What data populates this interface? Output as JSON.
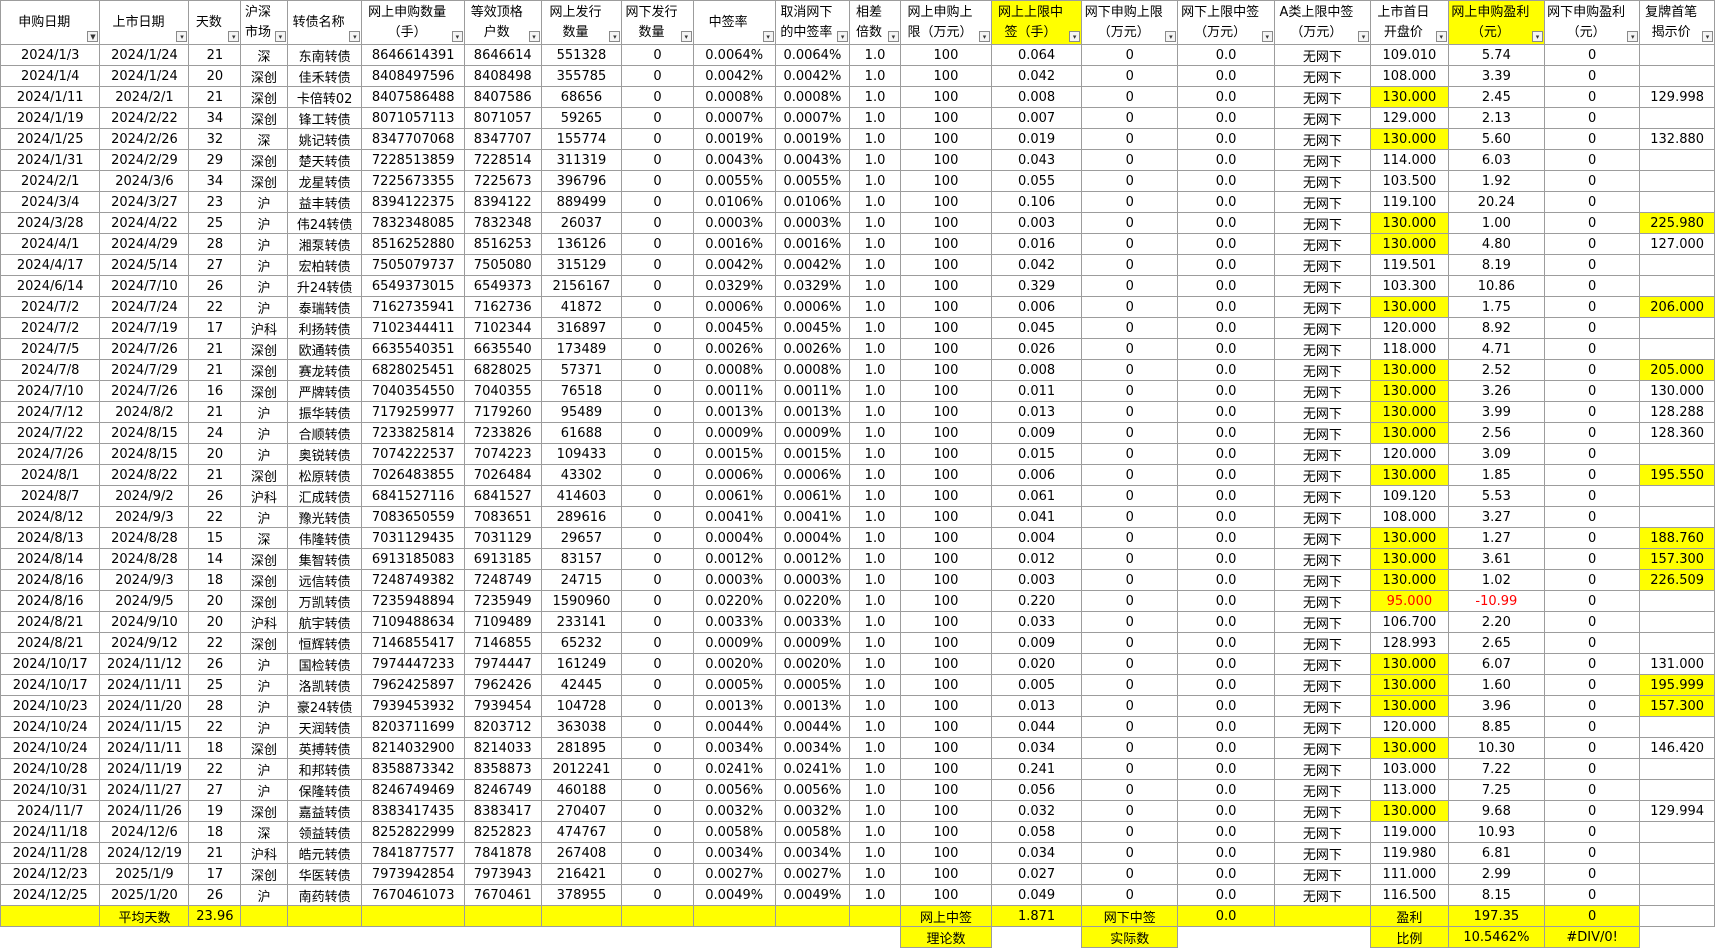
{
  "colors": {
    "highlight": "#ffff00",
    "negative": "#ff0000",
    "grid": "#9c9c9c"
  },
  "icons": {
    "filter": "filter-dropdown-icon",
    "filter_active": "filter-active-icon"
  },
  "headers": [
    {
      "label": "申购日期",
      "highlight": false,
      "filter_active": true
    },
    {
      "label": "上市日期",
      "highlight": false
    },
    {
      "label": "天数",
      "highlight": false
    },
    {
      "label": "沪深市场",
      "highlight": false
    },
    {
      "label": "转债名称",
      "highlight": false
    },
    {
      "label": "网上申购数量（手）",
      "highlight": false
    },
    {
      "label": "等效顶格户数",
      "highlight": false
    },
    {
      "label": "网上发行数量",
      "highlight": false
    },
    {
      "label": "网下发行数量",
      "highlight": false
    },
    {
      "label": "中签率",
      "highlight": false
    },
    {
      "label": "取消网下的中签率",
      "highlight": false
    },
    {
      "label": "相差倍数",
      "highlight": false
    },
    {
      "label": "网上申购上限（万元）",
      "highlight": false
    },
    {
      "label": "网上上限中签（手）",
      "highlight": true
    },
    {
      "label": "网下申购上限（万元）",
      "highlight": false
    },
    {
      "label": "网下上限中签（万元）",
      "highlight": false
    },
    {
      "label": "A类上限中签（万元）",
      "highlight": false
    },
    {
      "label": "上市首日开盘价",
      "highlight": false
    },
    {
      "label": "网上申购盈利（元）",
      "highlight": true
    },
    {
      "label": "网下申购盈利（元）",
      "highlight": false
    },
    {
      "label": "复牌首笔揭示价",
      "highlight": false
    }
  ],
  "rows": [
    {
      "c": [
        "2024/1/3",
        "2024/1/24",
        "21",
        "深",
        "东南转债",
        "8646614391",
        "8646614",
        "551328",
        "0",
        "0.0064%",
        "0.0064%",
        "1.0",
        "100",
        "0.064",
        "0",
        "0.0",
        "无网下",
        "109.010",
        "5.74",
        "0",
        ""
      ]
    },
    {
      "c": [
        "2024/1/4",
        "2024/1/24",
        "20",
        "深创",
        "佳禾转债",
        "8408497596",
        "8408498",
        "355785",
        "0",
        "0.0042%",
        "0.0042%",
        "1.0",
        "100",
        "0.042",
        "0",
        "0.0",
        "无网下",
        "108.000",
        "3.39",
        "0",
        ""
      ]
    },
    {
      "c": [
        "2024/1/11",
        "2024/2/1",
        "21",
        "深创",
        "卡倍转02",
        "8407586488",
        "8407586",
        "68656",
        "0",
        "0.0008%",
        "0.0008%",
        "1.0",
        "100",
        "0.008",
        "0",
        "0.0",
        "无网下",
        "130.000",
        "2.45",
        "0",
        "129.998"
      ],
      "hl_open": true
    },
    {
      "c": [
        "2024/1/19",
        "2024/2/22",
        "34",
        "深创",
        "锋工转债",
        "8071057113",
        "8071057",
        "59265",
        "0",
        "0.0007%",
        "0.0007%",
        "1.0",
        "100",
        "0.007",
        "0",
        "0.0",
        "无网下",
        "129.000",
        "2.13",
        "0",
        ""
      ]
    },
    {
      "c": [
        "2024/1/25",
        "2024/2/26",
        "32",
        "深",
        "姚记转债",
        "8347707068",
        "8347707",
        "155774",
        "0",
        "0.0019%",
        "0.0019%",
        "1.0",
        "100",
        "0.019",
        "0",
        "0.0",
        "无网下",
        "130.000",
        "5.60",
        "0",
        "132.880"
      ],
      "hl_open": true
    },
    {
      "c": [
        "2024/1/31",
        "2024/2/29",
        "29",
        "深创",
        "楚天转债",
        "7228513859",
        "7228514",
        "311319",
        "0",
        "0.0043%",
        "0.0043%",
        "1.0",
        "100",
        "0.043",
        "0",
        "0.0",
        "无网下",
        "114.000",
        "6.03",
        "0",
        ""
      ]
    },
    {
      "c": [
        "2024/2/1",
        "2024/3/6",
        "34",
        "深创",
        "龙星转债",
        "7225673355",
        "7225673",
        "396796",
        "0",
        "0.0055%",
        "0.0055%",
        "1.0",
        "100",
        "0.055",
        "0",
        "0.0",
        "无网下",
        "103.500",
        "1.92",
        "0",
        ""
      ]
    },
    {
      "c": [
        "2024/3/4",
        "2024/3/27",
        "23",
        "沪",
        "益丰转债",
        "8394122375",
        "8394122",
        "889499",
        "0",
        "0.0106%",
        "0.0106%",
        "1.0",
        "100",
        "0.106",
        "0",
        "0.0",
        "无网下",
        "119.100",
        "20.24",
        "0",
        ""
      ]
    },
    {
      "c": [
        "2024/3/28",
        "2024/4/22",
        "25",
        "沪",
        "伟24转债",
        "7832348085",
        "7832348",
        "26037",
        "0",
        "0.0003%",
        "0.0003%",
        "1.0",
        "100",
        "0.003",
        "0",
        "0.0",
        "无网下",
        "130.000",
        "1.00",
        "0",
        "225.980"
      ],
      "hl_open": true,
      "hl_last": true
    },
    {
      "c": [
        "2024/4/1",
        "2024/4/29",
        "28",
        "沪",
        "湘泵转债",
        "8516252880",
        "8516253",
        "136126",
        "0",
        "0.0016%",
        "0.0016%",
        "1.0",
        "100",
        "0.016",
        "0",
        "0.0",
        "无网下",
        "130.000",
        "4.80",
        "0",
        "127.000"
      ],
      "hl_open": true
    },
    {
      "c": [
        "2024/4/17",
        "2024/5/14",
        "27",
        "沪",
        "宏柏转债",
        "7505079737",
        "7505080",
        "315129",
        "0",
        "0.0042%",
        "0.0042%",
        "1.0",
        "100",
        "0.042",
        "0",
        "0.0",
        "无网下",
        "119.501",
        "8.19",
        "0",
        ""
      ]
    },
    {
      "c": [
        "2024/6/14",
        "2024/7/10",
        "26",
        "沪",
        "升24转债",
        "6549373015",
        "6549373",
        "2156167",
        "0",
        "0.0329%",
        "0.0329%",
        "1.0",
        "100",
        "0.329",
        "0",
        "0.0",
        "无网下",
        "103.300",
        "10.86",
        "0",
        ""
      ]
    },
    {
      "c": [
        "2024/7/2",
        "2024/7/24",
        "22",
        "沪",
        "泰瑞转债",
        "7162735941",
        "7162736",
        "41872",
        "0",
        "0.0006%",
        "0.0006%",
        "1.0",
        "100",
        "0.006",
        "0",
        "0.0",
        "无网下",
        "130.000",
        "1.75",
        "0",
        "206.000"
      ],
      "hl_open": true,
      "hl_last": true
    },
    {
      "c": [
        "2024/7/2",
        "2024/7/19",
        "17",
        "沪科",
        "利扬转债",
        "7102344411",
        "7102344",
        "316897",
        "0",
        "0.0045%",
        "0.0045%",
        "1.0",
        "100",
        "0.045",
        "0",
        "0.0",
        "无网下",
        "120.000",
        "8.92",
        "0",
        ""
      ]
    },
    {
      "c": [
        "2024/7/5",
        "2024/7/26",
        "21",
        "深创",
        "欧通转债",
        "6635540351",
        "6635540",
        "173489",
        "0",
        "0.0026%",
        "0.0026%",
        "1.0",
        "100",
        "0.026",
        "0",
        "0.0",
        "无网下",
        "118.000",
        "4.71",
        "0",
        ""
      ]
    },
    {
      "c": [
        "2024/7/8",
        "2024/7/29",
        "21",
        "深创",
        "赛龙转债",
        "6828025451",
        "6828025",
        "57371",
        "0",
        "0.0008%",
        "0.0008%",
        "1.0",
        "100",
        "0.008",
        "0",
        "0.0",
        "无网下",
        "130.000",
        "2.52",
        "0",
        "205.000"
      ],
      "hl_open": true,
      "hl_last": true
    },
    {
      "c": [
        "2024/7/10",
        "2024/7/26",
        "16",
        "深创",
        "严牌转债",
        "7040354550",
        "7040355",
        "76518",
        "0",
        "0.0011%",
        "0.0011%",
        "1.0",
        "100",
        "0.011",
        "0",
        "0.0",
        "无网下",
        "130.000",
        "3.26",
        "0",
        "130.000"
      ],
      "hl_open": true
    },
    {
      "c": [
        "2024/7/12",
        "2024/8/2",
        "21",
        "沪",
        "振华转债",
        "7179259977",
        "7179260",
        "95489",
        "0",
        "0.0013%",
        "0.0013%",
        "1.0",
        "100",
        "0.013",
        "0",
        "0.0",
        "无网下",
        "130.000",
        "3.99",
        "0",
        "128.288"
      ],
      "hl_open": true
    },
    {
      "c": [
        "2024/7/22",
        "2024/8/15",
        "24",
        "沪",
        "合顺转债",
        "7233825814",
        "7233826",
        "61688",
        "0",
        "0.0009%",
        "0.0009%",
        "1.0",
        "100",
        "0.009",
        "0",
        "0.0",
        "无网下",
        "130.000",
        "2.56",
        "0",
        "128.360"
      ],
      "hl_open": true
    },
    {
      "c": [
        "2024/7/26",
        "2024/8/15",
        "20",
        "沪",
        "奥锐转债",
        "7074222537",
        "7074223",
        "109433",
        "0",
        "0.0015%",
        "0.0015%",
        "1.0",
        "100",
        "0.015",
        "0",
        "0.0",
        "无网下",
        "120.000",
        "3.09",
        "0",
        ""
      ]
    },
    {
      "c": [
        "2024/8/1",
        "2024/8/22",
        "21",
        "深创",
        "松原转债",
        "7026483855",
        "7026484",
        "43302",
        "0",
        "0.0006%",
        "0.0006%",
        "1.0",
        "100",
        "0.006",
        "0",
        "0.0",
        "无网下",
        "130.000",
        "1.85",
        "0",
        "195.550"
      ],
      "hl_open": true,
      "hl_last": true
    },
    {
      "c": [
        "2024/8/7",
        "2024/9/2",
        "26",
        "沪科",
        "汇成转债",
        "6841527116",
        "6841527",
        "414603",
        "0",
        "0.0061%",
        "0.0061%",
        "1.0",
        "100",
        "0.061",
        "0",
        "0.0",
        "无网下",
        "109.120",
        "5.53",
        "0",
        ""
      ]
    },
    {
      "c": [
        "2024/8/12",
        "2024/9/3",
        "22",
        "沪",
        "豫光转债",
        "7083650559",
        "7083651",
        "289616",
        "0",
        "0.0041%",
        "0.0041%",
        "1.0",
        "100",
        "0.041",
        "0",
        "0.0",
        "无网下",
        "108.000",
        "3.27",
        "0",
        ""
      ]
    },
    {
      "c": [
        "2024/8/13",
        "2024/8/28",
        "15",
        "深",
        "伟隆转债",
        "7031129435",
        "7031129",
        "29657",
        "0",
        "0.0004%",
        "0.0004%",
        "1.0",
        "100",
        "0.004",
        "0",
        "0.0",
        "无网下",
        "130.000",
        "1.27",
        "0",
        "188.760"
      ],
      "hl_open": true,
      "hl_last": true
    },
    {
      "c": [
        "2024/8/14",
        "2024/8/28",
        "14",
        "深创",
        "集智转债",
        "6913185083",
        "6913185",
        "83157",
        "0",
        "0.0012%",
        "0.0012%",
        "1.0",
        "100",
        "0.012",
        "0",
        "0.0",
        "无网下",
        "130.000",
        "3.61",
        "0",
        "157.300"
      ],
      "hl_open": true,
      "hl_last": true
    },
    {
      "c": [
        "2024/8/16",
        "2024/9/3",
        "18",
        "深创",
        "远信转债",
        "7248749382",
        "7248749",
        "24715",
        "0",
        "0.0003%",
        "0.0003%",
        "1.0",
        "100",
        "0.003",
        "0",
        "0.0",
        "无网下",
        "130.000",
        "1.02",
        "0",
        "226.509"
      ],
      "hl_open": true,
      "hl_last": true
    },
    {
      "c": [
        "2024/8/16",
        "2024/9/5",
        "20",
        "深创",
        "万凯转债",
        "7235948894",
        "7235949",
        "1590960",
        "0",
        "0.0220%",
        "0.0220%",
        "1.0",
        "100",
        "0.220",
        "0",
        "0.0",
        "无网下",
        "95.000",
        "-10.99",
        "0",
        ""
      ],
      "hl_open": true,
      "neg": true
    },
    {
      "c": [
        "2024/8/21",
        "2024/9/10",
        "20",
        "沪科",
        "航宇转债",
        "7109488634",
        "7109489",
        "233141",
        "0",
        "0.0033%",
        "0.0033%",
        "1.0",
        "100",
        "0.033",
        "0",
        "0.0",
        "无网下",
        "106.700",
        "2.20",
        "0",
        ""
      ]
    },
    {
      "c": [
        "2024/8/21",
        "2024/9/12",
        "22",
        "深创",
        "恒辉转债",
        "7146855417",
        "7146855",
        "65232",
        "0",
        "0.0009%",
        "0.0009%",
        "1.0",
        "100",
        "0.009",
        "0",
        "0.0",
        "无网下",
        "128.993",
        "2.65",
        "0",
        ""
      ]
    },
    {
      "c": [
        "2024/10/17",
        "2024/11/12",
        "26",
        "沪",
        "国检转债",
        "7974447233",
        "7974447",
        "161249",
        "0",
        "0.0020%",
        "0.0020%",
        "1.0",
        "100",
        "0.020",
        "0",
        "0.0",
        "无网下",
        "130.000",
        "6.07",
        "0",
        "131.000"
      ],
      "hl_open": true
    },
    {
      "c": [
        "2024/10/17",
        "2024/11/11",
        "25",
        "沪",
        "洛凯转债",
        "7962425897",
        "7962426",
        "42445",
        "0",
        "0.0005%",
        "0.0005%",
        "1.0",
        "100",
        "0.005",
        "0",
        "0.0",
        "无网下",
        "130.000",
        "1.60",
        "0",
        "195.999"
      ],
      "hl_open": true,
      "hl_last": true
    },
    {
      "c": [
        "2024/10/23",
        "2024/11/20",
        "28",
        "沪",
        "豪24转债",
        "7939453932",
        "7939454",
        "104728",
        "0",
        "0.0013%",
        "0.0013%",
        "1.0",
        "100",
        "0.013",
        "0",
        "0.0",
        "无网下",
        "130.000",
        "3.96",
        "0",
        "157.300"
      ],
      "hl_open": true,
      "hl_last": true
    },
    {
      "c": [
        "2024/10/24",
        "2024/11/15",
        "22",
        "沪",
        "天润转债",
        "8203711699",
        "8203712",
        "363038",
        "0",
        "0.0044%",
        "0.0044%",
        "1.0",
        "100",
        "0.044",
        "0",
        "0.0",
        "无网下",
        "120.000",
        "8.85",
        "0",
        ""
      ]
    },
    {
      "c": [
        "2024/10/24",
        "2024/11/11",
        "18",
        "深创",
        "英搏转债",
        "8214032900",
        "8214033",
        "281895",
        "0",
        "0.0034%",
        "0.0034%",
        "1.0",
        "100",
        "0.034",
        "0",
        "0.0",
        "无网下",
        "130.000",
        "10.30",
        "0",
        "146.420"
      ],
      "hl_open": true
    },
    {
      "c": [
        "2024/10/28",
        "2024/11/19",
        "22",
        "沪",
        "和邦转债",
        "8358873342",
        "8358873",
        "2012241",
        "0",
        "0.0241%",
        "0.0241%",
        "1.0",
        "100",
        "0.241",
        "0",
        "0.0",
        "无网下",
        "103.000",
        "7.22",
        "0",
        ""
      ]
    },
    {
      "c": [
        "2024/10/31",
        "2024/11/27",
        "27",
        "沪",
        "保隆转债",
        "8246749469",
        "8246749",
        "460188",
        "0",
        "0.0056%",
        "0.0056%",
        "1.0",
        "100",
        "0.056",
        "0",
        "0.0",
        "无网下",
        "113.000",
        "7.25",
        "0",
        ""
      ]
    },
    {
      "c": [
        "2024/11/7",
        "2024/11/26",
        "19",
        "深创",
        "嘉益转债",
        "8383417435",
        "8383417",
        "270407",
        "0",
        "0.0032%",
        "0.0032%",
        "1.0",
        "100",
        "0.032",
        "0",
        "0.0",
        "无网下",
        "130.000",
        "9.68",
        "0",
        "129.994"
      ],
      "hl_open": true
    },
    {
      "c": [
        "2024/11/18",
        "2024/12/6",
        "18",
        "深",
        "领益转债",
        "8252822999",
        "8252823",
        "474767",
        "0",
        "0.0058%",
        "0.0058%",
        "1.0",
        "100",
        "0.058",
        "0",
        "0.0",
        "无网下",
        "119.000",
        "10.93",
        "0",
        ""
      ]
    },
    {
      "c": [
        "2024/11/28",
        "2024/12/19",
        "21",
        "沪科",
        "皓元转债",
        "7841877577",
        "7841878",
        "267408",
        "0",
        "0.0034%",
        "0.0034%",
        "1.0",
        "100",
        "0.034",
        "0",
        "0.0",
        "无网下",
        "119.980",
        "6.81",
        "0",
        ""
      ]
    },
    {
      "c": [
        "2024/12/23",
        "2025/1/9",
        "17",
        "深创",
        "华医转债",
        "7973942854",
        "7973943",
        "216421",
        "0",
        "0.0027%",
        "0.0027%",
        "1.0",
        "100",
        "0.027",
        "0",
        "0.0",
        "无网下",
        "111.000",
        "2.99",
        "0",
        ""
      ]
    },
    {
      "c": [
        "2024/12/25",
        "2025/1/20",
        "26",
        "沪",
        "南药转债",
        "7670461073",
        "7670461",
        "378955",
        "0",
        "0.0049%",
        "0.0049%",
        "1.0",
        "100",
        "0.049",
        "0",
        "0.0",
        "无网下",
        "116.500",
        "8.15",
        "0",
        ""
      ]
    }
  ],
  "summary1": {
    "avg_days_label": "平均天数",
    "avg_days": "23.96",
    "online_win_label": "网上中签",
    "online_win": "1.871",
    "offline_win_label": "网下中签",
    "offline_win": "0.0",
    "profit_label": "盈利",
    "profit_online": "197.35",
    "profit_offline": "0"
  },
  "summary2": {
    "theory_label": "理论数",
    "actual_label": "实际数",
    "ratio_label": "比例",
    "ratio_online": "10.5462%",
    "ratio_offline": "#DIV/0!"
  }
}
